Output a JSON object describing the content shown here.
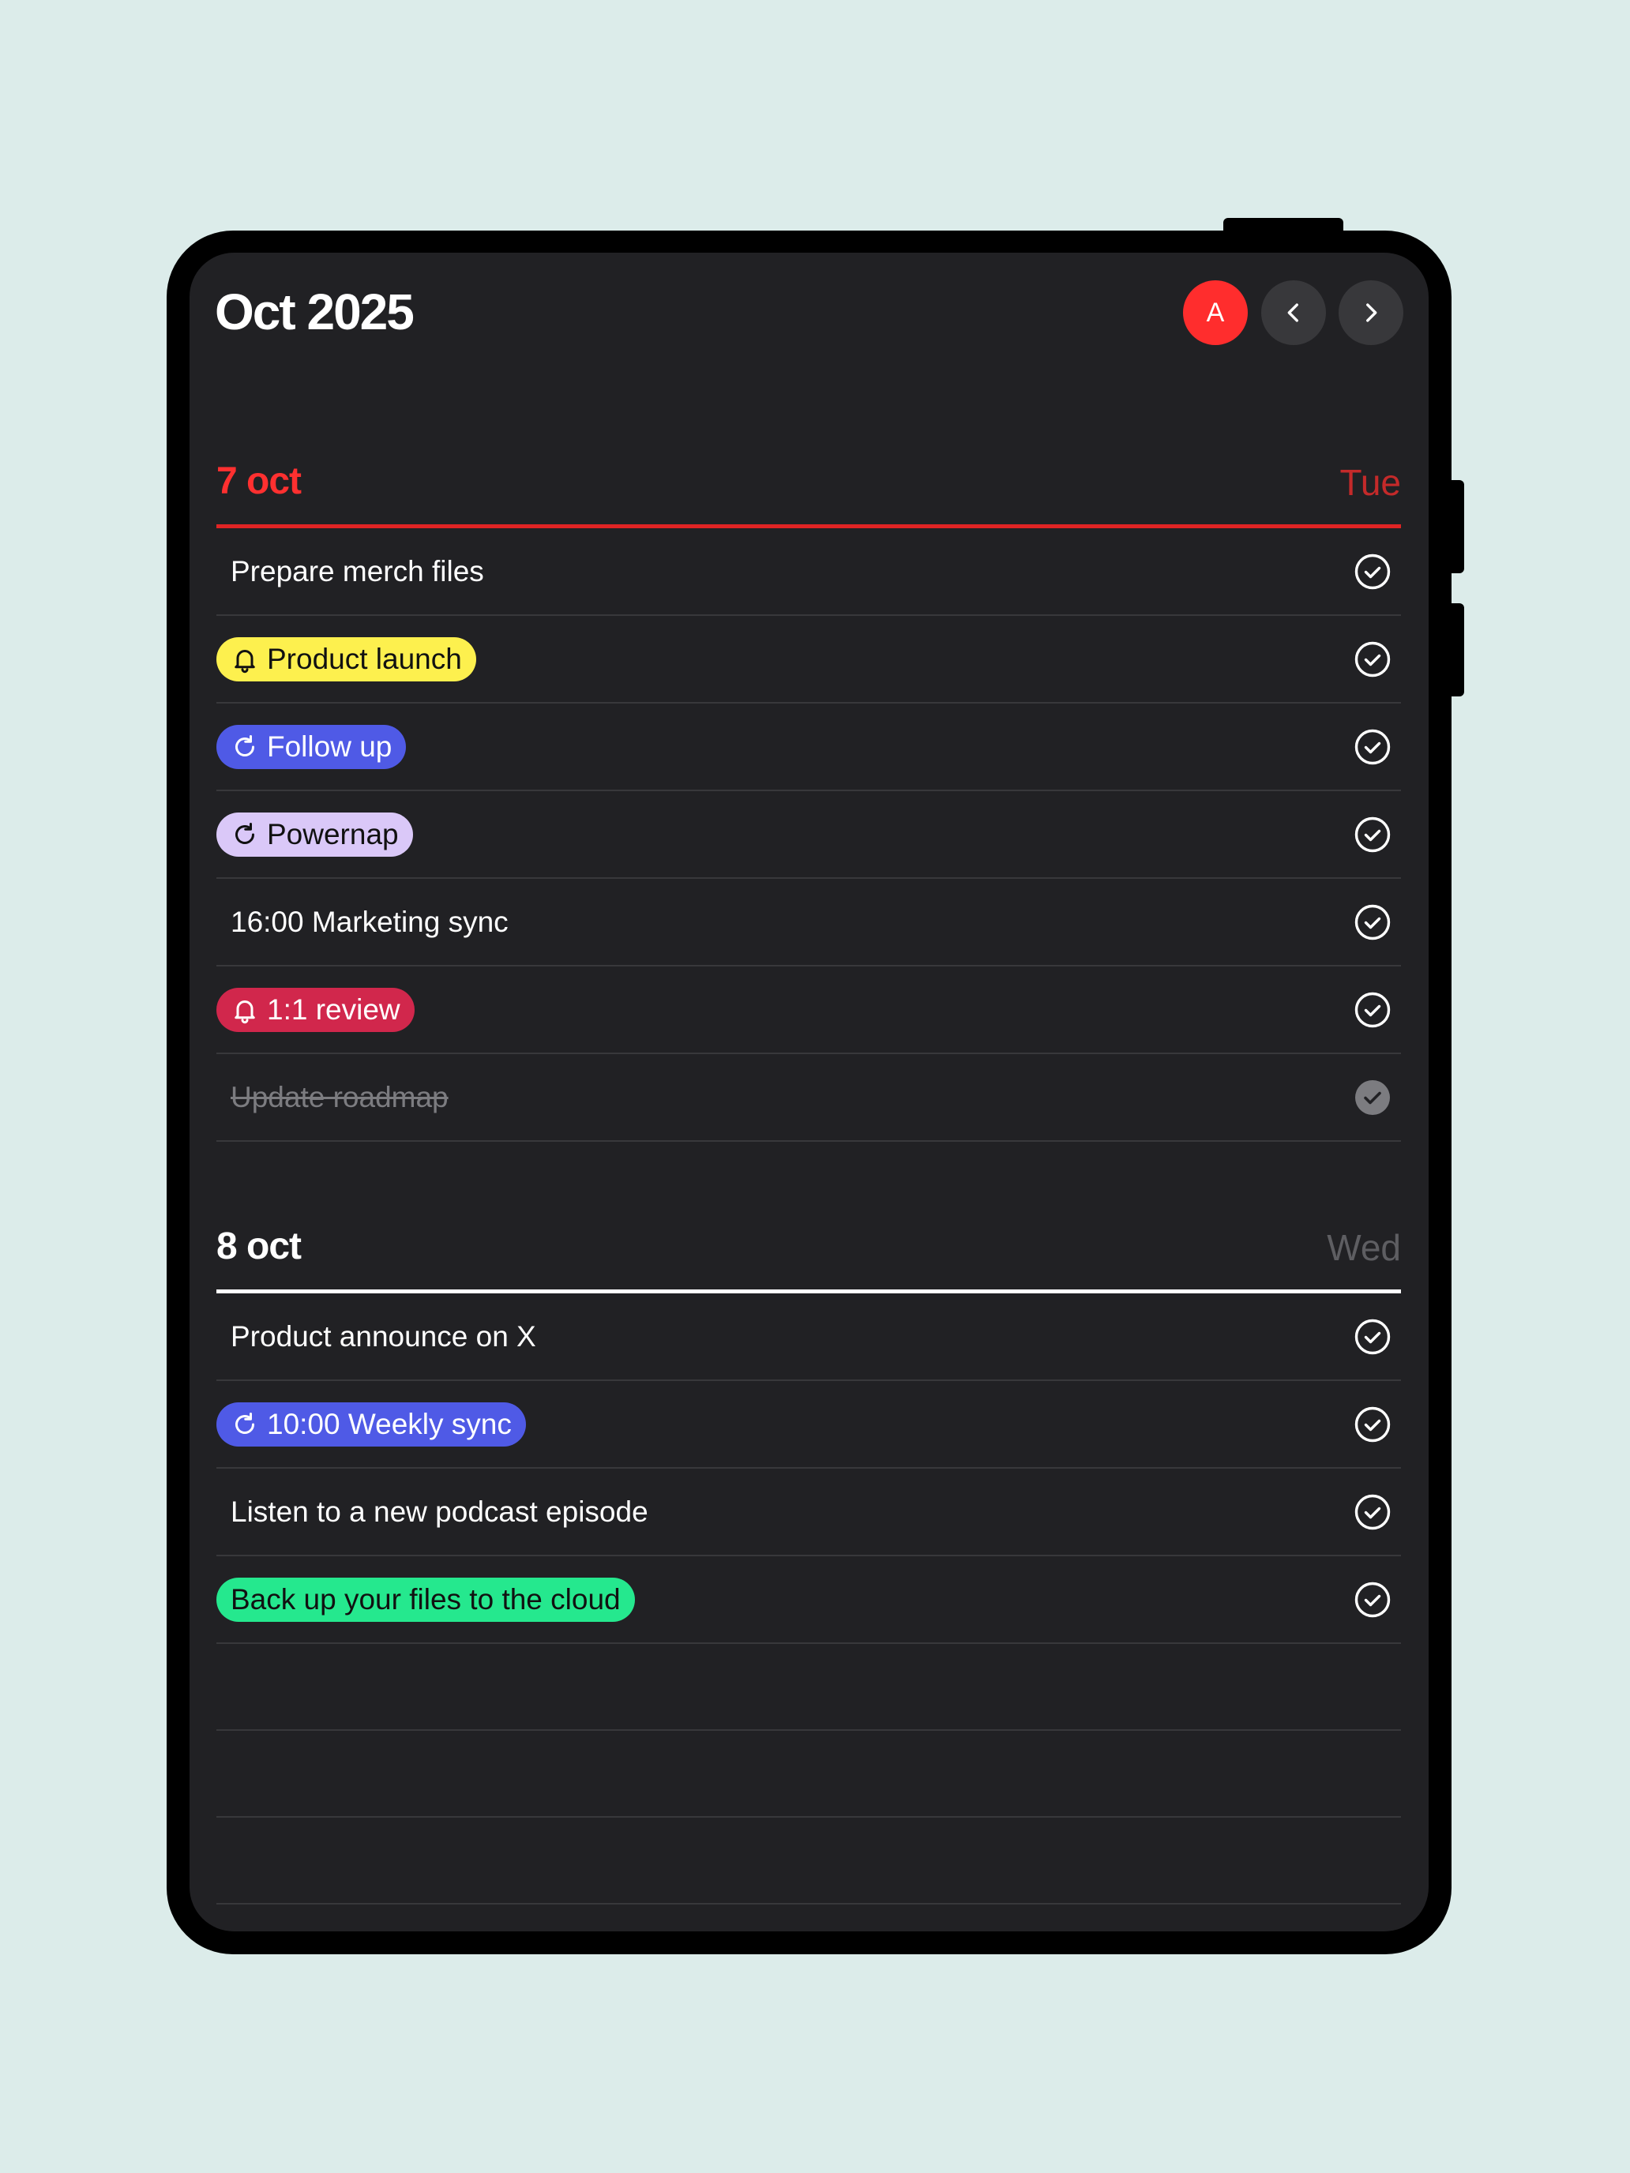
{
  "header": {
    "title": "Oct 2025",
    "avatar_letter": "A",
    "prev_icon": "chevron-left-icon",
    "next_icon": "chevron-right-icon"
  },
  "colors": {
    "background": "#dcecea",
    "screen": "#212124",
    "today_accent": "#ff3030",
    "chip_yellow": "#fdf04e",
    "chip_blue": "#4f5ae6",
    "chip_lavender": "#dac8f8",
    "chip_crimson": "#d1274c",
    "chip_green": "#25e88e"
  },
  "days": [
    {
      "date": "7 oct",
      "weekday": "Tue",
      "items": [
        {
          "text": "Prepare merch files"
        },
        {
          "text": "Product launch",
          "icon": "bell-icon",
          "chip": "yellow"
        },
        {
          "text": "Follow up",
          "icon": "repeat-icon",
          "chip": "blue"
        },
        {
          "text": "Powernap",
          "icon": "repeat-icon",
          "chip": "lavender"
        },
        {
          "text": "16:00 Marketing sync"
        },
        {
          "text": "1:1 review",
          "icon": "bell-icon",
          "chip": "crimson"
        },
        {
          "text": "Update roadmap",
          "done": true
        }
      ]
    },
    {
      "date": "8 oct",
      "weekday": "Wed",
      "items": [
        {
          "text": "Product announce on X"
        },
        {
          "text": "10:00 Weekly sync",
          "icon": "repeat-icon",
          "chip": "blue"
        },
        {
          "text": "Listen to a new podcast episode"
        },
        {
          "text": "Back up your files to the cloud",
          "chip": "green"
        }
      ]
    }
  ],
  "view_switcher": {
    "options": [
      "grid-view-icon",
      "split-view-icon",
      "single-view-icon"
    ],
    "selected": "split-view-icon"
  }
}
